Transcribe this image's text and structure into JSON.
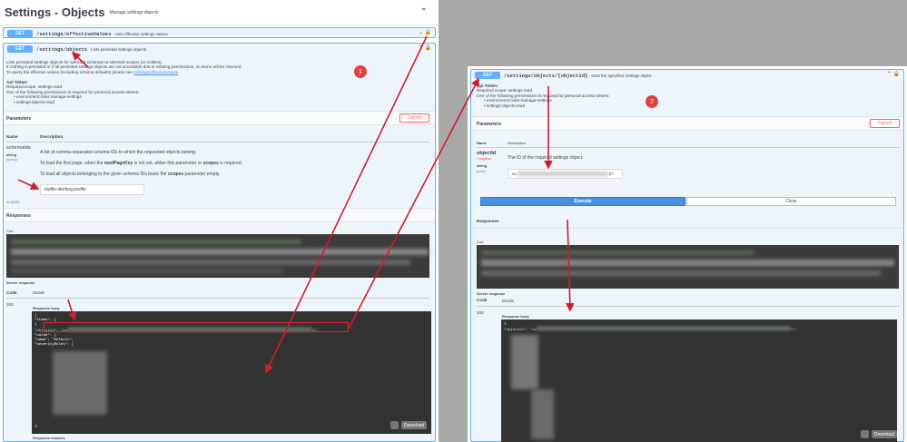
{
  "left": {
    "title": "Settings - Objects",
    "subtitle": "Manage settings objects",
    "op1": {
      "method": "GET",
      "path": "/settings/effectiveValues",
      "summary": "Lists effective settings values"
    },
    "op2": {
      "method": "GET",
      "path": "/settings/objects",
      "summary": "Lists persisted settings objects"
    },
    "desc1": "Lists persisted settings objects for selected schemas at selected scopes (or entities).",
    "desc2": "If nothing is persisted or if all persisted settings objects are not accessible due to missing permissions, no items will be returned.",
    "desc3": "To query the effective values (including schema defaults) please see",
    "desc3_link": "/settings/effectiveValues",
    "token_title": "Api-Token:",
    "token_scope": "Required scope: settings.read",
    "token_perm": "One of the following permissions is required for personal access tokens:",
    "perm1": "environment:roles:manage-settings",
    "perm2": "settings:objects:read",
    "params_label": "Parameters",
    "cancel": "Cancel",
    "col_name": "Name",
    "col_desc": "Description",
    "param_name": "schemaIds",
    "param_type": "string",
    "param_in": "(query)",
    "param_d1": "A list of comma-separated schema IDs to which the requested objects belong.",
    "param_d2a": "To load the first page, when the",
    "param_d2b": "nextPageKey",
    "param_d2c": "is not set, either this parameter or",
    "param_d2d": "scopes",
    "param_d2e": "is required.",
    "param_d3a": "To load all objects belonging to the given schema IDs leave the",
    "param_d3b": "scopes",
    "param_d3c": "parameter empty.",
    "param_value": "builtin:alerting.profile",
    "scopes": "scopes",
    "responses": "Responses",
    "curl": "Curl",
    "server_response": "Server response",
    "code_h": "Code",
    "details_h": "Details",
    "code_val": "200",
    "resp_body": "Response body",
    "json_l1": "{",
    "json_l2": "  \"items\": [",
    "json_l3": "    {",
    "json_l4a": "      \"objectId\": \"vu",
    "json_l4b": "=\",",
    "json_l5": "      \"value\": {",
    "json_l6": "        \"name\": \"Default\",",
    "json_l7": "        \"severityRules\": [",
    "json_end": "      },",
    "download": "Download",
    "resp_headers": "Response headers",
    "marker": "1"
  },
  "right": {
    "op": {
      "method": "GET",
      "path": "/settings/objects/{objectId}",
      "summary": "Gets the specified settings object"
    },
    "token_title": "Api-Token:",
    "token_scope": "Required scope: settings.read",
    "token_perm": "One of the following permissions is required for personal access tokens:",
    "perm1": "environment:roles:manage-settings",
    "perm2": "settings:objects:read",
    "params_label": "Parameters",
    "cancel": "Cancel",
    "col_name": "Name",
    "col_desc": "Description",
    "param_name": "objectId",
    "param_req": "* required",
    "param_type": "string",
    "param_in": "(path)",
    "param_desc": "The ID of the required settings object.",
    "param_value_a": "vu",
    "param_value_b": "Z>",
    "execute": "Execute",
    "clear": "Clear",
    "responses": "Responses",
    "curl": "Curl",
    "server_response": "Server response",
    "code_h": "Code",
    "details_h": "Details",
    "code_val": "200",
    "resp_body": "Response body",
    "json_l1": "{",
    "json_l2a": "  \"objectId\": \"vu",
    "json_l2b": "=\",",
    "download": "Download",
    "marker": "2"
  },
  "colors": {
    "get": "#61affe",
    "arrow": "#cc1f2b",
    "cancel": "#ff6060",
    "execute": "#4990e2"
  }
}
